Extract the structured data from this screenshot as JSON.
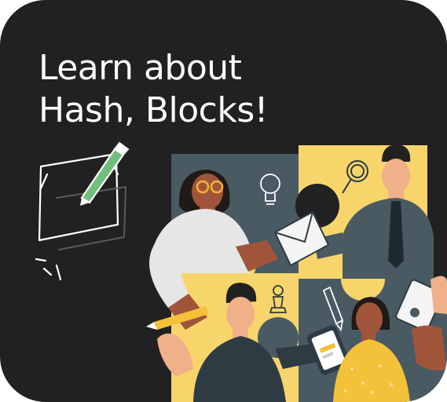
{
  "card": {
    "title_line1": "Learn about",
    "title_line2": "Hash, Blocks!"
  },
  "colors": {
    "background": "#212121",
    "title_text": "#ffffff",
    "puzzle_yellow": "#f8d56b",
    "puzzle_slate": "#4a5a63",
    "pencil_green": "#6fbf7f"
  },
  "illustration": {
    "subject": "team-collaboration-puzzle",
    "icons": [
      "pencil-paper-icon",
      "lightbulb-icon",
      "magnifier-icon",
      "chess-pawn-icon",
      "pencil-icon",
      "envelope-icon",
      "phone-icon",
      "clipboard-icon"
    ]
  }
}
